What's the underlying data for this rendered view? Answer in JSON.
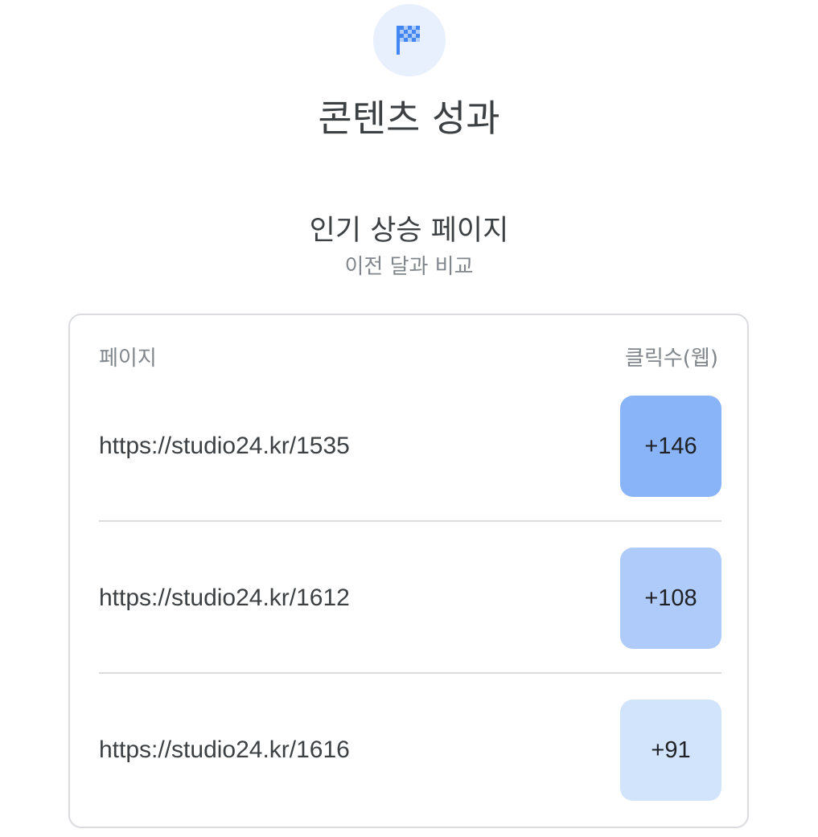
{
  "header": {
    "icon": "checkered-flag-icon",
    "title": "콘텐츠 성과"
  },
  "section": {
    "title": "인기 상승 페이지",
    "subtitle": "이전 달과 비교"
  },
  "table": {
    "columns": {
      "page": "페이지",
      "clicks": "클릭수(웹)"
    },
    "rows": [
      {
        "url": "https://studio24.kr/1535",
        "clicks": "+146",
        "color": "#8ab4f8"
      },
      {
        "url": "https://studio24.kr/1612",
        "clicks": "+108",
        "color": "#aecbfa"
      },
      {
        "url": "https://studio24.kr/1616",
        "clicks": "+91",
        "color": "#d2e3fc"
      }
    ]
  },
  "colors": {
    "accent": "#4285f4",
    "badge_bg": "#e8f0fe",
    "border": "#dadce0"
  }
}
